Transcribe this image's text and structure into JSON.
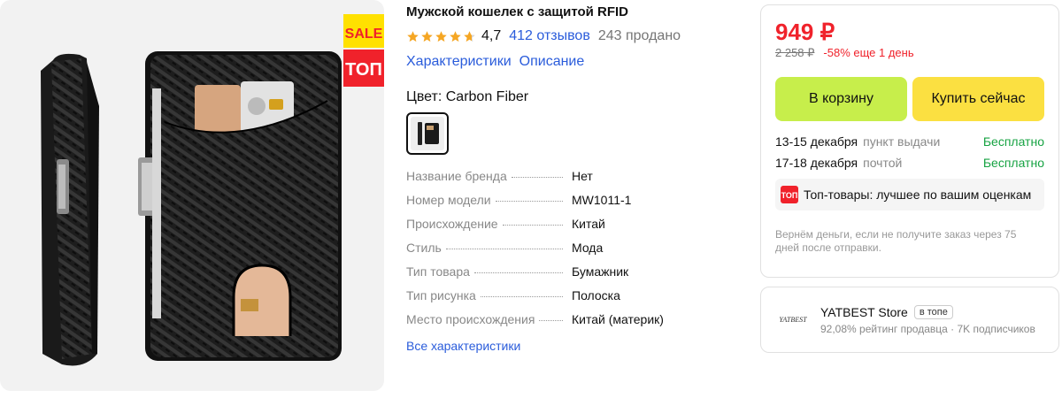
{
  "product": {
    "title": "Мужской кошелек с защитой RFID",
    "rating": "4,7",
    "rating_value": 4.7,
    "reviews": "412 отзывов",
    "sold": "243 продано",
    "links": [
      "Характеристики",
      "Описание"
    ],
    "color_label": "Цвет: Carbon Fiber",
    "sale_badge": {
      "top": "SALE",
      "bottom": "ТОП"
    },
    "specs": [
      {
        "key": "Название бренда",
        "value": "Нет"
      },
      {
        "key": "Номер модели",
        "value": "MW1011-1"
      },
      {
        "key": "Происхождение",
        "value": "Китай"
      },
      {
        "key": "Стиль",
        "value": "Мода"
      },
      {
        "key": "Тип товара",
        "value": "Бумажник"
      },
      {
        "key": "Тип рисунка",
        "value": "Полоска"
      },
      {
        "key": "Место происхождения",
        "value": "Китай (материк)"
      }
    ],
    "all_specs": "Все характеристики"
  },
  "buy": {
    "price": "949 ₽",
    "old_price": "2 258 ₽",
    "discount": "-58% еще 1 день",
    "cart_label": "В корзину",
    "buy_now_label": "Купить сейчас",
    "delivery": [
      {
        "date": "13-15 декабря",
        "type": "пункт выдачи",
        "price": "Бесплатно"
      },
      {
        "date": "17-18 декабря",
        "type": "почтой",
        "price": "Бесплатно"
      }
    ],
    "top_badge": "ТОП",
    "top_banner": "Топ-товары: лучшее по вашим оценкам",
    "refund": "Вернём деньги, если не получите заказ через 75 дней после отправки."
  },
  "store": {
    "logo": "YATBEST",
    "name": "YATBEST Store",
    "badge": "в топе",
    "meta": "92,08% рейтинг продавца · 7K подписчиков"
  },
  "colors": {
    "accent_blue": "#2a5cdb",
    "price_red": "#f0222b",
    "cart_green": "#c7ee4b",
    "buy_yellow": "#fbe041",
    "free_green": "#17a343",
    "star_orange": "#f5a623"
  }
}
